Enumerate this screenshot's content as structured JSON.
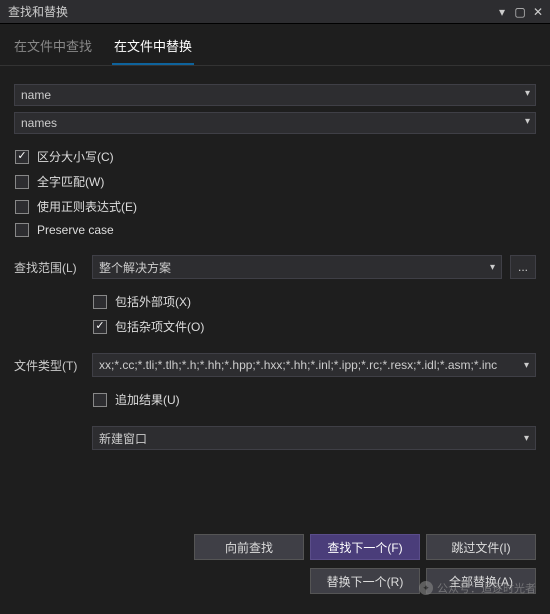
{
  "window": {
    "title": "查找和替换"
  },
  "tabs": {
    "find_in_files": "在文件中查找",
    "replace_in_files": "在文件中替换"
  },
  "fields": {
    "find_value": "name",
    "replace_value": "names"
  },
  "options": {
    "match_case": "区分大小写(C)",
    "whole_word": "全字匹配(W)",
    "regex": "使用正则表达式(E)",
    "preserve_case": "Preserve case"
  },
  "scope": {
    "label": "查找范围(L)",
    "value": "整个解决方案",
    "include_external": "包括外部项(X)",
    "include_misc": "包括杂项文件(O)"
  },
  "filetype": {
    "label": "文件类型(T)",
    "value": "xx;*.cc;*.tli;*.tlh;*.h;*.hh;*.hpp;*.hxx;*.hh;*.inl;*.ipp;*.rc;*.resx;*.idl;*.asm;*.inc"
  },
  "results": {
    "append": "追加结果(U)",
    "window": "新建窗口"
  },
  "buttons": {
    "find_prev": "向前查找",
    "find_next": "查找下一个(F)",
    "skip_file": "跳过文件(I)",
    "replace_next": "替换下一个(R)",
    "replace_all": "全部替换(A)"
  },
  "watermark": {
    "text": "公众号：追逐时光者"
  }
}
